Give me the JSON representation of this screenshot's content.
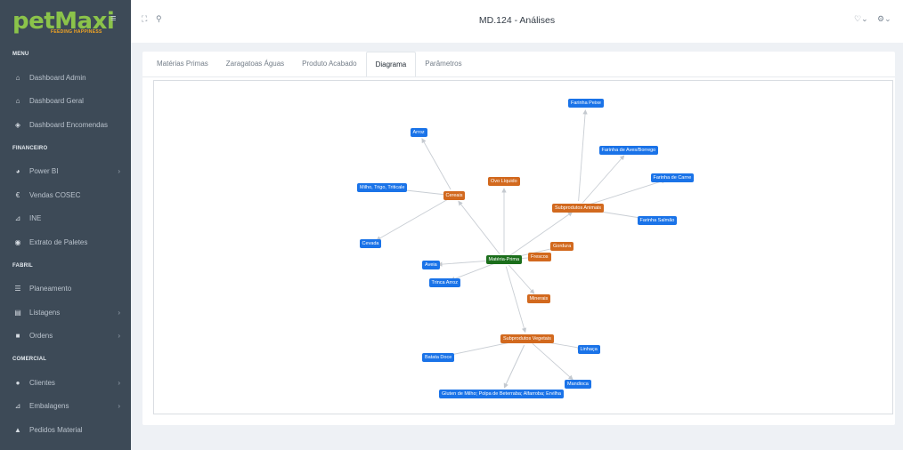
{
  "logo": {
    "name": "petMaxi",
    "tagline": "FEEDING HAPPINESS"
  },
  "sidebar": {
    "sections": {
      "menu": "MENU",
      "financeiro": "FINANCEIRO",
      "fabril": "FABRIL",
      "comercial": "COMERCIAL"
    },
    "items": {
      "dashboard_admin": "Dashboard Admin",
      "dashboard_geral": "Dashboard Geral",
      "dashboard_encomendas": "Dashboard Encomendas",
      "power_bi": "Power BI",
      "vendas_cosec": "Vendas COSEC",
      "ine": "INE",
      "extrato_paletes": "Extrato de Paletes",
      "planeamento": "Planeamento",
      "listagens": "Listagens",
      "ordens": "Ordens",
      "clientes": "Clientes",
      "embalagens": "Embalagens",
      "pedidos_material": "Pedidos Material"
    }
  },
  "header": {
    "title": "MD.124 - Análises"
  },
  "tabs": [
    "Matérias Primas",
    "Zaragatoas Águas",
    "Produto Acabado",
    "Diagrama",
    "Parâmetros"
  ],
  "active_tab": "Diagrama",
  "diagram": {
    "nodes": {
      "root": "Matéria-Prima",
      "cereais": "Cereais",
      "ovo": "Ovo Líquido",
      "sub_animais": "Subprodutos Animais",
      "gordura": "Gordura",
      "frescos": "Frescos",
      "minerais": "Minerais",
      "sub_vegetais": "Subprodutos Vegetais",
      "arroz": "Arroz",
      "milho_trigo": "Milho, Trigo, Triticale",
      "cevada": "Cevada",
      "aveia": "Aveia",
      "trinca_arroz": "Trinca Arroz",
      "farinha_peixe": "Farinha Peixe",
      "farinha_aves": "Farinha de Aves/Borrego",
      "farinha_carne": "Farinha de Carne",
      "farinha_salmao": "Farinha Salmão",
      "batata_doce": "Batata Doce",
      "linhaca": "Linhaça",
      "mandioca": "Mandioca",
      "gluten": "Gluten de Milho; Polpa de Beterraba; Alfarroba; Ervilha"
    }
  },
  "colors": {
    "sidebar_bg": "#3d4a57",
    "brand_green": "#8bc34a",
    "node_blue": "#1a73e8",
    "node_orange": "#d2691e",
    "node_green": "#1b6e1b"
  }
}
